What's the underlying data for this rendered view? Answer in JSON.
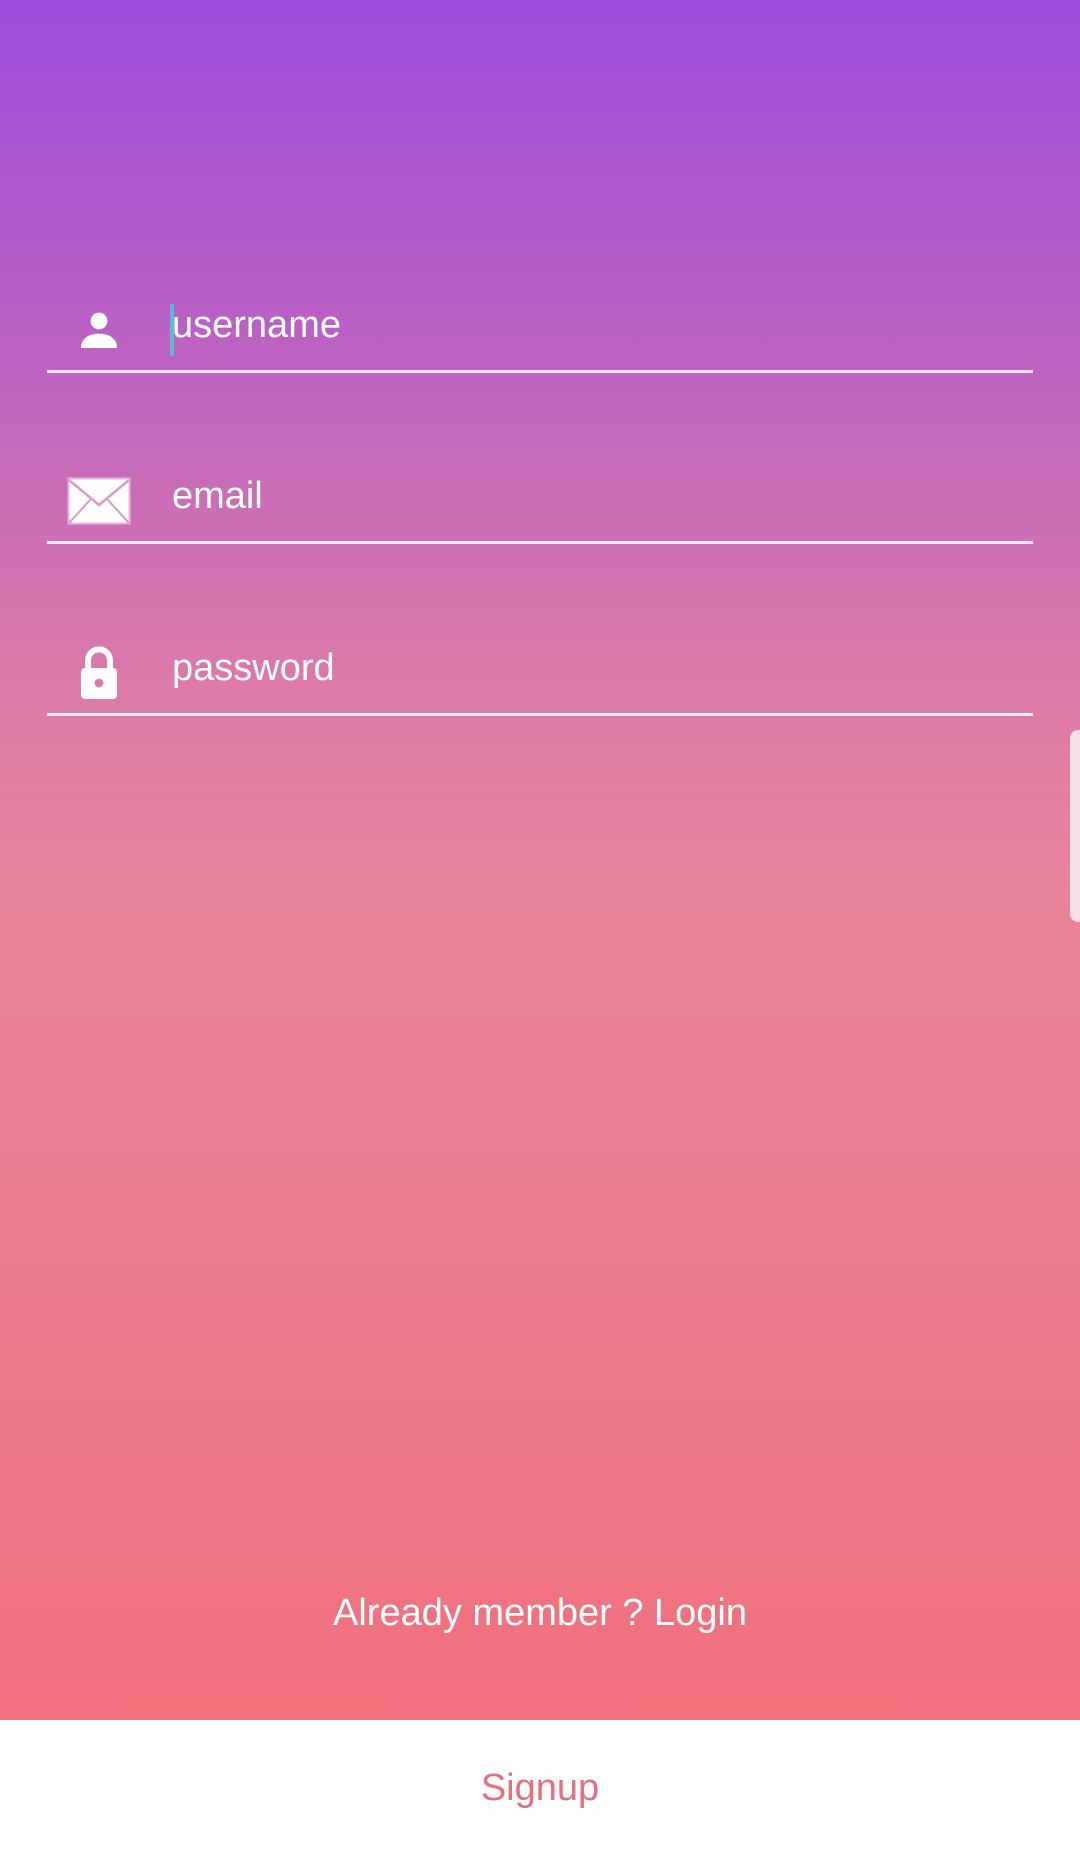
{
  "form": {
    "username": {
      "placeholder": "username",
      "value": "",
      "icon": "person-icon"
    },
    "email": {
      "placeholder": "email",
      "value": "",
      "icon": "envelope-icon"
    },
    "password": {
      "placeholder": "password",
      "value": "",
      "icon": "lock-icon"
    }
  },
  "login_link": {
    "label": "Already member ? Login"
  },
  "signup_button": {
    "label": "Signup"
  },
  "colors": {
    "gradient_top": "#9b4cde",
    "gradient_bottom": "#f0707c",
    "signup_text": "#e56f7d",
    "cursor": "#5fb7d6"
  }
}
